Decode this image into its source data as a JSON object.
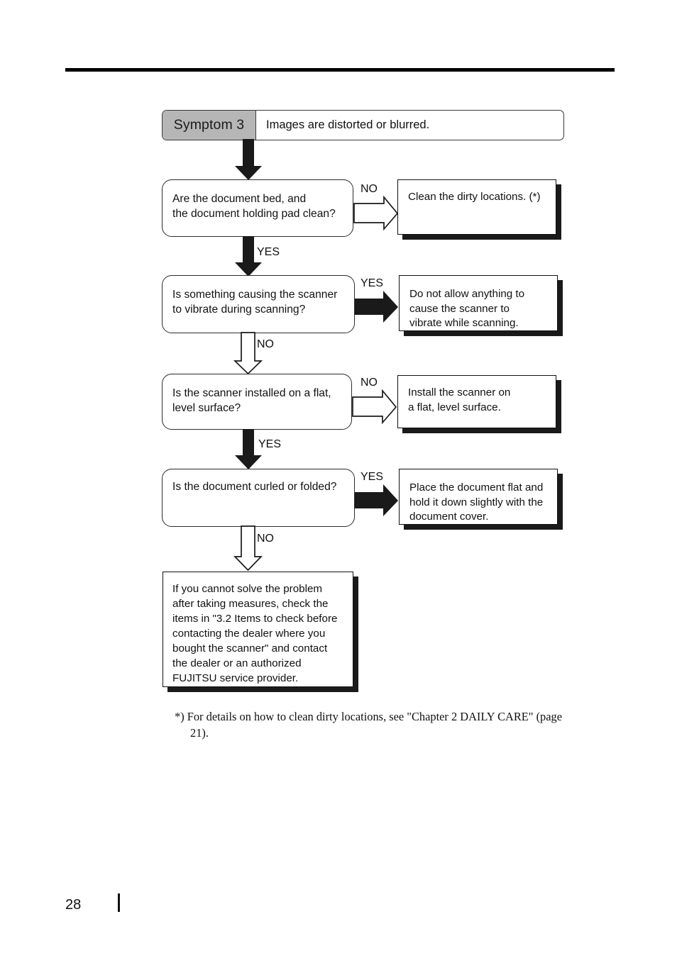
{
  "document": {
    "page_number": "28",
    "footer_divider": "|"
  },
  "symptom": {
    "tag": "Symptom 3",
    "description": "Images are distorted or blurred."
  },
  "labels": {
    "yes": "YES",
    "no": "NO"
  },
  "flow": {
    "decisions": [
      {
        "id": "decision-document-bed-clean",
        "line1": "Are the document bed, and",
        "line2": "the document holding pad clean?",
        "no_branch": "NO",
        "yes_branch": "YES"
      },
      {
        "id": "decision-scanner-vibrating",
        "line1": "Is something causing the scanner",
        "line2": "to vibrate during scanning?",
        "yes_branch": "YES",
        "no_branch": "NO"
      },
      {
        "id": "decision-flat-level-surface",
        "line1": "Is the scanner installed on a flat,",
        "line2": "level surface?",
        "no_branch": "NO",
        "yes_branch": "YES"
      },
      {
        "id": "decision-document-curled",
        "line1": "Is the document curled or folded?",
        "line2": "",
        "yes_branch": "YES",
        "no_branch": "NO"
      }
    ],
    "actions": [
      {
        "id": "action-clean-dirty-locations",
        "line1": "Clean the dirty locations. (*)",
        "line2": "",
        "line3": ""
      },
      {
        "id": "action-prevent-vibration",
        "line1": "Do not allow anything to",
        "line2": "cause the scanner to",
        "line3": "vibrate while scanning."
      },
      {
        "id": "action-install-flat-surface",
        "line1": "Install the scanner on",
        "line2": "a flat, level surface.",
        "line3": ""
      },
      {
        "id": "action-place-document-flat",
        "line1": "Place the document flat and",
        "line2": "hold it down slightly with the",
        "line3": "document cover."
      }
    ],
    "final_note": {
      "line1": "If you cannot solve the problem",
      "line2": "after taking measures, check the",
      "line3": "items in \"3.2 Items to check before",
      "line4": "contacting the dealer where you",
      "line5": "bought the scanner\" and contact",
      "line6": "the dealer or an authorized",
      "line7": "FUJITSU service provider."
    }
  },
  "footnote": {
    "line1": "*) For details on how to clean dirty locations, see \"Chapter 2 DAILY CARE\" (page",
    "line2": "21)."
  },
  "colors": {
    "symptom_tag_background": "#b6b6b6",
    "ink": "#111111",
    "shadow": "#1a1a1a"
  }
}
